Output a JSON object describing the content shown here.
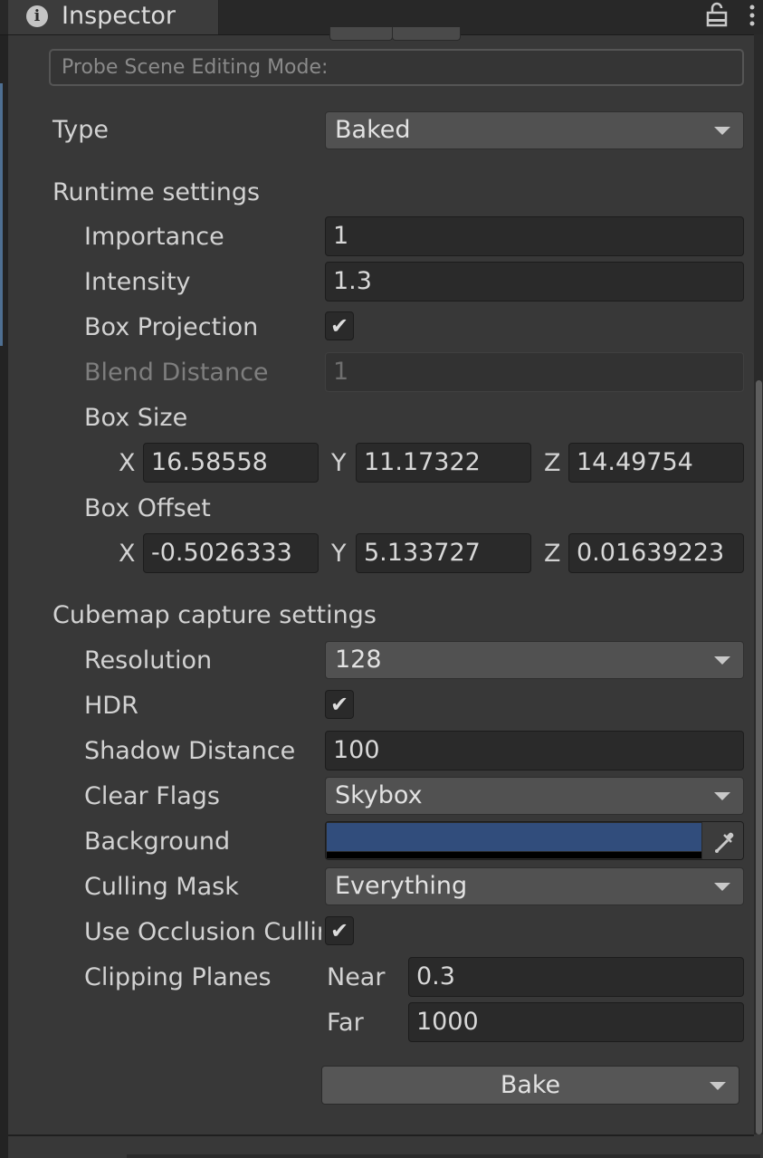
{
  "window": {
    "tab_title": "Inspector",
    "tab_icon": "info-icon",
    "lock_icon": "lock-icon",
    "menu_icon": "kebab-menu-icon"
  },
  "editing_mode": {
    "label": "Probe Scene Editing Mode:"
  },
  "type": {
    "label": "Type",
    "value": "Baked"
  },
  "runtime": {
    "header": "Runtime settings",
    "importance": {
      "label": "Importance",
      "value": "1"
    },
    "intensity": {
      "label": "Intensity",
      "value": "1.3"
    },
    "box_projection": {
      "label": "Box Projection",
      "checked": true
    },
    "blend_distance": {
      "label": "Blend Distance",
      "value": "1"
    },
    "box_size": {
      "label": "Box Size",
      "x_label": "X",
      "x": "16.58558",
      "y_label": "Y",
      "y": "11.17322",
      "z_label": "Z",
      "z": "14.49754"
    },
    "box_offset": {
      "label": "Box Offset",
      "x_label": "X",
      "x": "-0.5026333",
      "y_label": "Y",
      "y": "5.133727",
      "z_label": "Z",
      "z": "0.01639223"
    }
  },
  "cubemap": {
    "header": "Cubemap capture settings",
    "resolution": {
      "label": "Resolution",
      "value": "128"
    },
    "hdr": {
      "label": "HDR",
      "checked": true
    },
    "shadow_distance": {
      "label": "Shadow Distance",
      "value": "100"
    },
    "clear_flags": {
      "label": "Clear Flags",
      "value": "Skybox"
    },
    "background": {
      "label": "Background",
      "color": "#314d7c"
    },
    "culling_mask": {
      "label": "Culling Mask",
      "value": "Everything"
    },
    "use_occlusion": {
      "label": "Use Occlusion Culling",
      "checked": true
    },
    "clipping_planes": {
      "label": "Clipping Planes",
      "near_label": "Near",
      "near": "0.3",
      "far_label": "Far",
      "far": "1000"
    }
  },
  "bake_button": {
    "label": "Bake"
  },
  "colors": {
    "panel_bg": "#383838",
    "field_bg": "#2a2a2a",
    "dropdown_bg": "#515151",
    "scroll_thumb": "#5d5d5d"
  }
}
